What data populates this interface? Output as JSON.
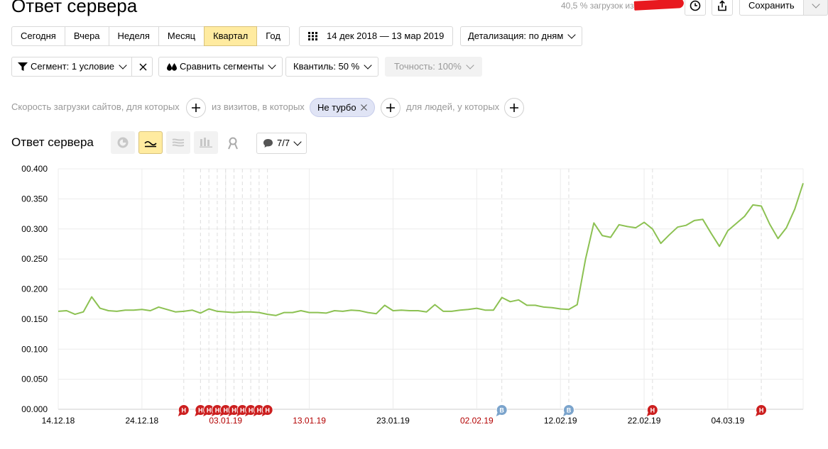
{
  "header": {
    "title": "Ответ сервера",
    "loads_info": "40,5 % загрузок из",
    "save_label": "Сохранить"
  },
  "period": {
    "buttons": [
      "Сегодня",
      "Вчера",
      "Неделя",
      "Месяц",
      "Квартал",
      "Год"
    ],
    "active": "Квартал",
    "date_range": "14 дек 2018 — 13 мар 2019",
    "detail_label": "Детализация: по дням"
  },
  "filters": {
    "segment_label": "Сегмент: 1 условие",
    "compare_label": "Сравнить сегменты",
    "quantile_label": "Квантиль: 50 %",
    "accuracy_label": "Точность: 100%"
  },
  "segment_builder": {
    "sites_text": "Скорость загрузки сайтов, для которых",
    "visits_text": "из визитов, в которых",
    "tag_label": "Не турбо",
    "people_text": "для людей, у которых"
  },
  "chart_header": {
    "title": "Ответ сервера",
    "annotations_label": "7/7"
  },
  "colors": {
    "line": "#8cc152",
    "accent": "#ffeba0",
    "holiday_marker": "#cc1f1f",
    "note_marker": "#7ba4cc",
    "holiday_text": "#b30000"
  },
  "chart_data": {
    "type": "line",
    "title": "",
    "xlabel": "",
    "ylabel": "",
    "ylim": [
      0,
      0.4
    ],
    "yticks": [
      "00.000",
      "00.050",
      "00.100",
      "00.150",
      "00.200",
      "00.250",
      "00.300",
      "00.350",
      "00.400"
    ],
    "x_start": "14.12.18",
    "x_end": "13.03.19",
    "xticks": [
      {
        "label": "14.12.18",
        "day": 0,
        "holiday": false
      },
      {
        "label": "24.12.18",
        "day": 10,
        "holiday": false
      },
      {
        "label": "03.01.19",
        "day": 20,
        "holiday": true
      },
      {
        "label": "13.01.19",
        "day": 30,
        "holiday": true
      },
      {
        "label": "23.01.19",
        "day": 40,
        "holiday": false
      },
      {
        "label": "02.02.19",
        "day": 50,
        "holiday": true
      },
      {
        "label": "12.02.19",
        "day": 60,
        "holiday": false
      },
      {
        "label": "22.02.19",
        "day": 70,
        "holiday": false
      },
      {
        "label": "04.03.19",
        "day": 80,
        "holiday": false
      }
    ],
    "series": [
      {
        "values": [
          0.163,
          0.164,
          0.158,
          0.162,
          0.187,
          0.168,
          0.164,
          0.163,
          0.165,
          0.165,
          0.166,
          0.164,
          0.17,
          0.166,
          0.162,
          0.163,
          0.165,
          0.16,
          0.167,
          0.163,
          0.162,
          0.161,
          0.162,
          0.162,
          0.161,
          0.158,
          0.156,
          0.161,
          0.161,
          0.164,
          0.161,
          0.161,
          0.16,
          0.164,
          0.163,
          0.165,
          0.164,
          0.161,
          0.159,
          0.173,
          0.164,
          0.165,
          0.164,
          0.164,
          0.162,
          0.174,
          0.163,
          0.163,
          0.165,
          0.166,
          0.168,
          0.165,
          0.165,
          0.186,
          0.179,
          0.182,
          0.173,
          0.173,
          0.17,
          0.169,
          0.167,
          0.166,
          0.174,
          0.25,
          0.31,
          0.289,
          0.286,
          0.307,
          0.304,
          0.302,
          0.311,
          0.3,
          0.276,
          0.29,
          0.303,
          0.306,
          0.314,
          0.316,
          0.293,
          0.271,
          0.297,
          0.309,
          0.321,
          0.34,
          0.338,
          0.308,
          0.284,
          0.302,
          0.333,
          0.376
        ]
      }
    ],
    "events": [
      {
        "label": "Н",
        "day": 15,
        "kind": "holiday"
      },
      {
        "label": "Н",
        "day": 17,
        "kind": "holiday"
      },
      {
        "label": "Н",
        "day": 18,
        "kind": "holiday"
      },
      {
        "label": "Н",
        "day": 19,
        "kind": "holiday"
      },
      {
        "label": "Н",
        "day": 20,
        "kind": "holiday"
      },
      {
        "label": "Н",
        "day": 21,
        "kind": "holiday"
      },
      {
        "label": "Н",
        "day": 22,
        "kind": "holiday"
      },
      {
        "label": "Н",
        "day": 23,
        "kind": "holiday"
      },
      {
        "label": "Н",
        "day": 24,
        "kind": "holiday"
      },
      {
        "label": "Н",
        "day": 25,
        "kind": "holiday"
      },
      {
        "label": "В",
        "day": 53,
        "kind": "note"
      },
      {
        "label": "В",
        "day": 61,
        "kind": "note"
      },
      {
        "label": "Н",
        "day": 71,
        "kind": "holiday"
      },
      {
        "label": "Н",
        "day": 84,
        "kind": "holiday"
      }
    ]
  }
}
